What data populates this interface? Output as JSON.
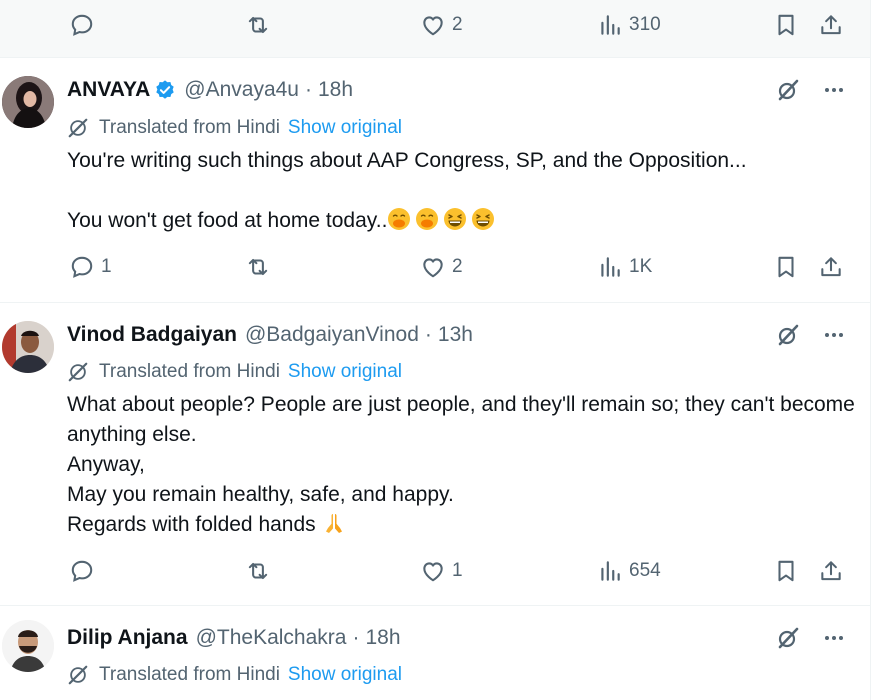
{
  "top_actions": {
    "likes": "2",
    "views": "310"
  },
  "tweets": [
    {
      "name": "ANVAYA",
      "handle": "@Anvaya4u",
      "time": "18h",
      "translated_label": "Translated from Hindi",
      "show_original": "Show original",
      "text": [
        "You're writing such things about AAP Congress, SP, and the Opposition...",
        "",
        "You won't get food at home today.."
      ],
      "replies": "1",
      "likes": "2",
      "views": "1K"
    },
    {
      "name": "Vinod Badgaiyan",
      "handle": "@BadgaiyanVinod",
      "time": "13h",
      "translated_label": "Translated from Hindi",
      "show_original": "Show original",
      "text": [
        "What about people? People are just people, and they'll remain so; they can't become anything else.",
        "Anyway,",
        "May you remain healthy, safe, and happy.",
        "Regards with folded hands"
      ],
      "replies": "",
      "likes": "1",
      "views": "654"
    },
    {
      "name": "Dilip Anjana",
      "handle": "@TheKalchakra",
      "time": "18h",
      "translated_label": "Translated from Hindi",
      "show_original": "Show original"
    }
  ],
  "separator": "·",
  "colors": {
    "accent": "#1d9bf0",
    "muted": "#536471",
    "text": "#0f1419"
  },
  "icons": [
    "reply-icon",
    "retweet-icon",
    "like-icon",
    "views-icon",
    "bookmark-icon",
    "share-icon",
    "grok-icon",
    "more-icon",
    "translate-icon",
    "verified-icon"
  ]
}
